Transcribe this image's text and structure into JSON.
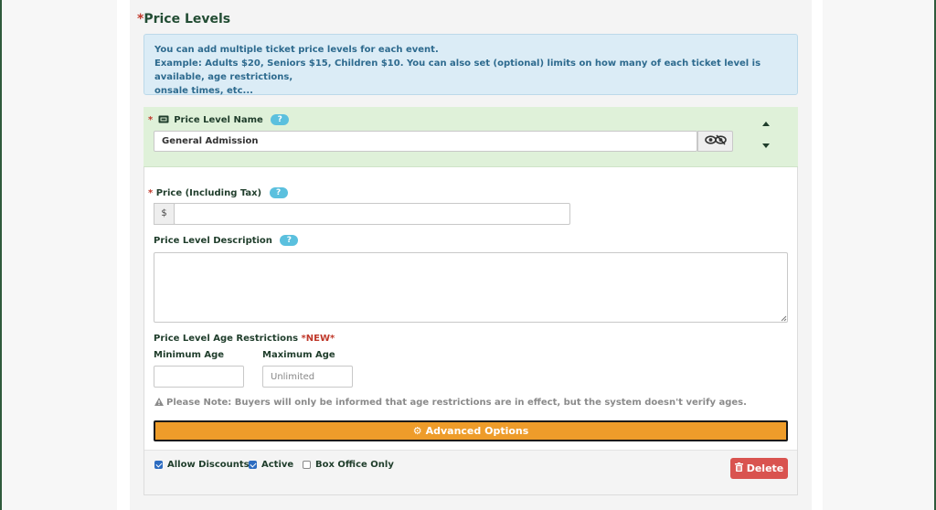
{
  "section": {
    "title": "Price Levels",
    "required_mark": "*"
  },
  "info": {
    "line1": "You can add multiple ticket price levels for each event.",
    "line2": "Example: Adults $20, Seniors $15, Children $10. You can also set (optional) limits on how many of each ticket level is available, age restrictions,",
    "line3": "onsale times, etc..."
  },
  "level": {
    "name_label": "Price Level Name",
    "name_value": "General Admission",
    "price_label": "Price (Including Tax)",
    "currency": "$",
    "price_value": "",
    "description_label": "Price Level Description",
    "description_value": "",
    "age_label": "Price Level Age Restrictions",
    "age_new_tag": "*NEW*",
    "min_age_label": "Minimum Age",
    "min_age_value": "",
    "max_age_label": "Maximum Age",
    "max_age_placeholder": "Unlimited",
    "note": "Please Note: Buyers will only be informed that age restrictions are in effect, but the system doesn't verify ages.",
    "advanced_label": "Advanced Options",
    "help_glyph": "?",
    "required_mark": "*"
  },
  "footer": {
    "allow_discounts": {
      "label": "Allow Discounts",
      "checked": true
    },
    "active": {
      "label": "Active",
      "checked": true
    },
    "box_office_only": {
      "label": "Box Office Only",
      "checked": false
    },
    "delete_label": "Delete"
  },
  "icons": {
    "ticket": "ticket-icon",
    "visibility": "eye-slash-icon",
    "move_up": "arrow-up-icon",
    "move_down": "arrow-down-icon",
    "help": "question-badge-icon",
    "warning": "warning-icon",
    "settings": "gear-icon",
    "delete": "trash-icon"
  },
  "colors": {
    "brand_green": "#234d34",
    "info_bg": "#dbecf6",
    "info_text": "#2d6a8e",
    "header_green": "#dff1d9",
    "advanced_orange": "#ee9c2a",
    "delete_red": "#d9534f",
    "help_blue": "#5bc0de",
    "required_red": "#c0392b"
  }
}
